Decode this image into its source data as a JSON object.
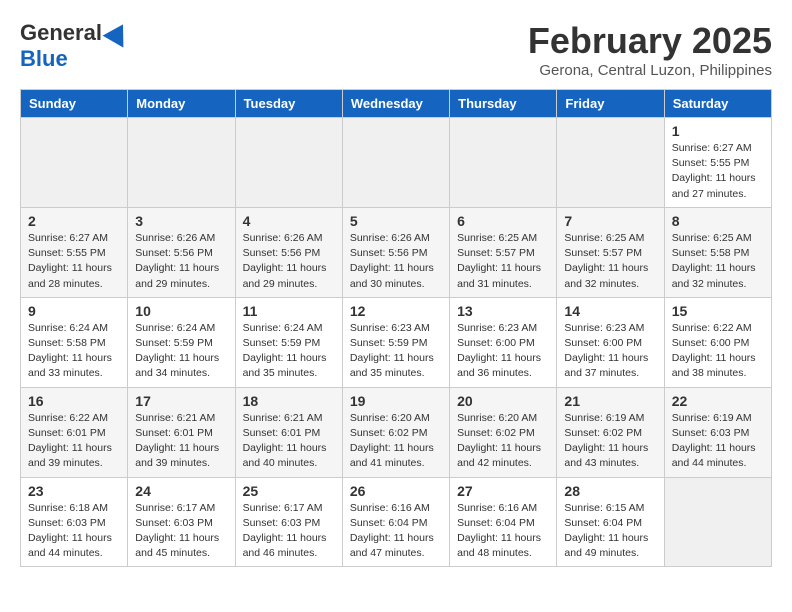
{
  "header": {
    "logo_general": "General",
    "logo_blue": "Blue",
    "month_title": "February 2025",
    "subtitle": "Gerona, Central Luzon, Philippines"
  },
  "weekdays": [
    "Sunday",
    "Monday",
    "Tuesday",
    "Wednesday",
    "Thursday",
    "Friday",
    "Saturday"
  ],
  "weeks": [
    [
      {
        "day": "",
        "info": ""
      },
      {
        "day": "",
        "info": ""
      },
      {
        "day": "",
        "info": ""
      },
      {
        "day": "",
        "info": ""
      },
      {
        "day": "",
        "info": ""
      },
      {
        "day": "",
        "info": ""
      },
      {
        "day": "1",
        "info": "Sunrise: 6:27 AM\nSunset: 5:55 PM\nDaylight: 11 hours and 27 minutes."
      }
    ],
    [
      {
        "day": "2",
        "info": "Sunrise: 6:27 AM\nSunset: 5:55 PM\nDaylight: 11 hours and 28 minutes."
      },
      {
        "day": "3",
        "info": "Sunrise: 6:26 AM\nSunset: 5:56 PM\nDaylight: 11 hours and 29 minutes."
      },
      {
        "day": "4",
        "info": "Sunrise: 6:26 AM\nSunset: 5:56 PM\nDaylight: 11 hours and 29 minutes."
      },
      {
        "day": "5",
        "info": "Sunrise: 6:26 AM\nSunset: 5:56 PM\nDaylight: 11 hours and 30 minutes."
      },
      {
        "day": "6",
        "info": "Sunrise: 6:25 AM\nSunset: 5:57 PM\nDaylight: 11 hours and 31 minutes."
      },
      {
        "day": "7",
        "info": "Sunrise: 6:25 AM\nSunset: 5:57 PM\nDaylight: 11 hours and 32 minutes."
      },
      {
        "day": "8",
        "info": "Sunrise: 6:25 AM\nSunset: 5:58 PM\nDaylight: 11 hours and 32 minutes."
      }
    ],
    [
      {
        "day": "9",
        "info": "Sunrise: 6:24 AM\nSunset: 5:58 PM\nDaylight: 11 hours and 33 minutes."
      },
      {
        "day": "10",
        "info": "Sunrise: 6:24 AM\nSunset: 5:59 PM\nDaylight: 11 hours and 34 minutes."
      },
      {
        "day": "11",
        "info": "Sunrise: 6:24 AM\nSunset: 5:59 PM\nDaylight: 11 hours and 35 minutes."
      },
      {
        "day": "12",
        "info": "Sunrise: 6:23 AM\nSunset: 5:59 PM\nDaylight: 11 hours and 35 minutes."
      },
      {
        "day": "13",
        "info": "Sunrise: 6:23 AM\nSunset: 6:00 PM\nDaylight: 11 hours and 36 minutes."
      },
      {
        "day": "14",
        "info": "Sunrise: 6:23 AM\nSunset: 6:00 PM\nDaylight: 11 hours and 37 minutes."
      },
      {
        "day": "15",
        "info": "Sunrise: 6:22 AM\nSunset: 6:00 PM\nDaylight: 11 hours and 38 minutes."
      }
    ],
    [
      {
        "day": "16",
        "info": "Sunrise: 6:22 AM\nSunset: 6:01 PM\nDaylight: 11 hours and 39 minutes."
      },
      {
        "day": "17",
        "info": "Sunrise: 6:21 AM\nSunset: 6:01 PM\nDaylight: 11 hours and 39 minutes."
      },
      {
        "day": "18",
        "info": "Sunrise: 6:21 AM\nSunset: 6:01 PM\nDaylight: 11 hours and 40 minutes."
      },
      {
        "day": "19",
        "info": "Sunrise: 6:20 AM\nSunset: 6:02 PM\nDaylight: 11 hours and 41 minutes."
      },
      {
        "day": "20",
        "info": "Sunrise: 6:20 AM\nSunset: 6:02 PM\nDaylight: 11 hours and 42 minutes."
      },
      {
        "day": "21",
        "info": "Sunrise: 6:19 AM\nSunset: 6:02 PM\nDaylight: 11 hours and 43 minutes."
      },
      {
        "day": "22",
        "info": "Sunrise: 6:19 AM\nSunset: 6:03 PM\nDaylight: 11 hours and 44 minutes."
      }
    ],
    [
      {
        "day": "23",
        "info": "Sunrise: 6:18 AM\nSunset: 6:03 PM\nDaylight: 11 hours and 44 minutes."
      },
      {
        "day": "24",
        "info": "Sunrise: 6:17 AM\nSunset: 6:03 PM\nDaylight: 11 hours and 45 minutes."
      },
      {
        "day": "25",
        "info": "Sunrise: 6:17 AM\nSunset: 6:03 PM\nDaylight: 11 hours and 46 minutes."
      },
      {
        "day": "26",
        "info": "Sunrise: 6:16 AM\nSunset: 6:04 PM\nDaylight: 11 hours and 47 minutes."
      },
      {
        "day": "27",
        "info": "Sunrise: 6:16 AM\nSunset: 6:04 PM\nDaylight: 11 hours and 48 minutes."
      },
      {
        "day": "28",
        "info": "Sunrise: 6:15 AM\nSunset: 6:04 PM\nDaylight: 11 hours and 49 minutes."
      },
      {
        "day": "",
        "info": ""
      }
    ]
  ]
}
